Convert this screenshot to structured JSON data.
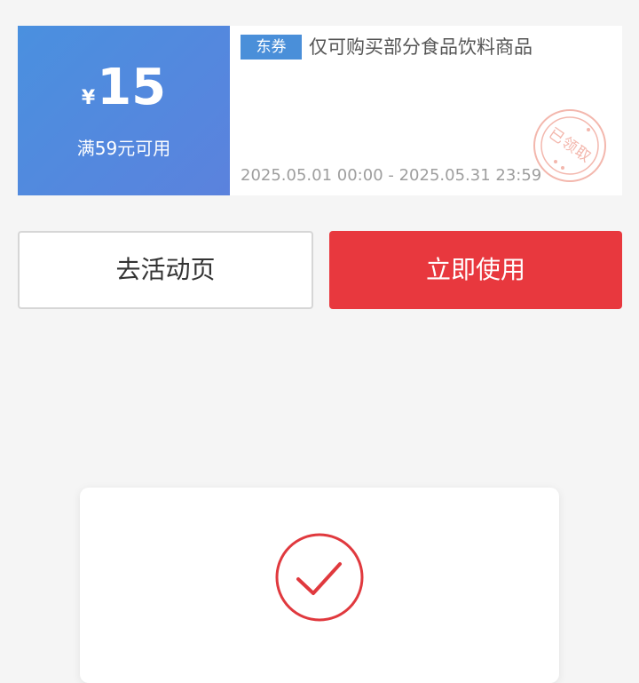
{
  "coupon": {
    "currency": "¥",
    "amount": "15",
    "condition": "满59元可用",
    "tag": "东券",
    "description": "仅可购买部分食品饮料商品",
    "validity": "2025.05.01 00:00 - 2025.05.31 23:59",
    "stamp": "已领取",
    "colors": {
      "left_gradient_start": "#4a90df",
      "left_gradient_end": "#5b82dd",
      "tag_bg": "#4a8fd9",
      "stamp": "#f3b7ad"
    },
    "icons": {
      "stamp": "received-stamp-icon"
    }
  },
  "actions": {
    "activity_page_label": "去活动页",
    "use_now_label": "立即使用",
    "primary_color": "#e8383e"
  },
  "dialog": {
    "icons": {
      "success": "check-circle-icon"
    },
    "icon_color": "#e0393e"
  }
}
